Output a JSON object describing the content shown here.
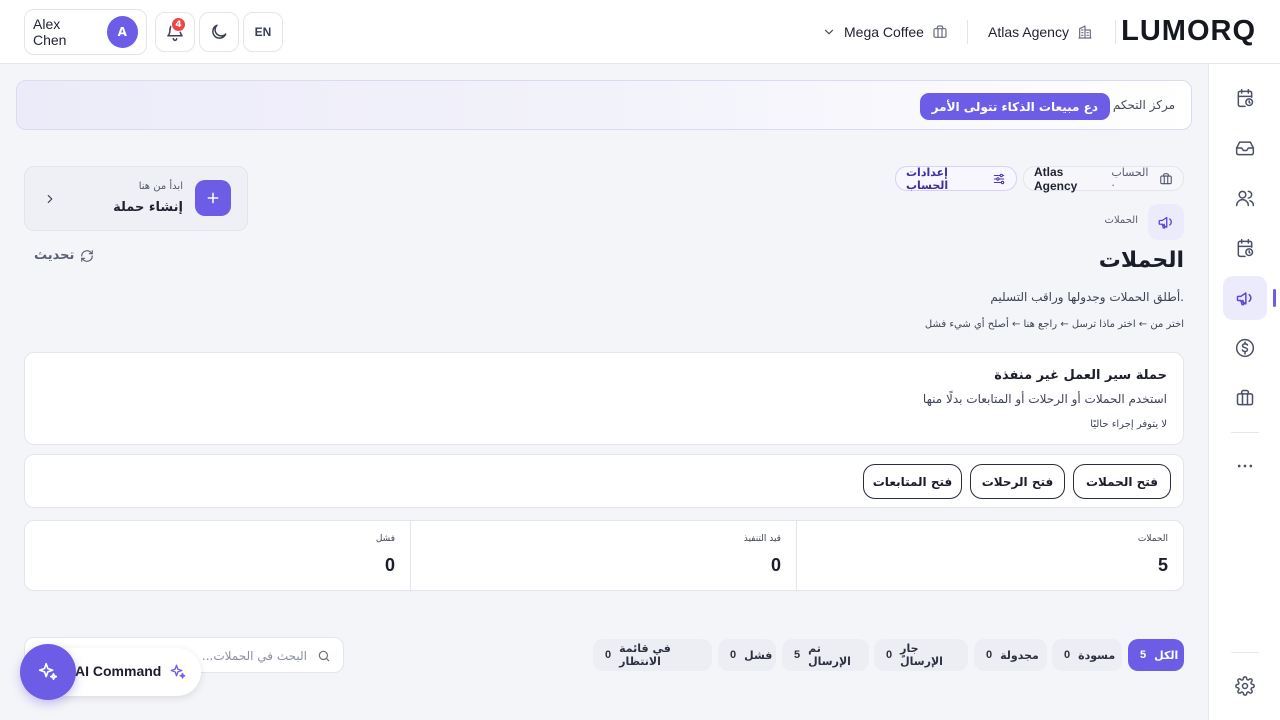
{
  "header": {
    "logo": "LUMORQ",
    "agency": "Atlas Agency",
    "brand": "Mega Coffee",
    "lang": "EN",
    "notifications": "4",
    "user_name": "Alex Chen",
    "avatar_initial": "A"
  },
  "banner": {
    "title": "مركز التحكم",
    "pill": "دع مبيعات الذكاء تتولى الأمر"
  },
  "create": {
    "subtitle": "ابدأ من هنا",
    "title": "إنشاء حملة"
  },
  "refresh_label": "تحديث",
  "account": {
    "prefix": "الحساب ·",
    "name": "Atlas Agency",
    "settings": "إعدادات الحساب"
  },
  "page": {
    "crumb": "الحملات",
    "title": "الحملات",
    "subtitle": "أطلق الحملات وجدولها وراقب التسليم.",
    "steps": "اختر من ← اختر ماذا ترسل ← راجع هنا ← أصلح أي شيء فشل"
  },
  "notice": {
    "title": "حملة سير العمل غير منفذة",
    "body": "استخدم الحملات أو الرحلات أو المتابعات بدلًا منها",
    "meta": "لا يتوفر إجراء حاليًا"
  },
  "open_buttons": [
    "فتح الحملات",
    "فتح الرحلات",
    "فتح المتابعات"
  ],
  "stats": [
    {
      "label": "الحملات",
      "value": "5"
    },
    {
      "label": "قيد التنفيذ",
      "value": "0"
    },
    {
      "label": "فشل",
      "value": "0"
    }
  ],
  "filters": [
    {
      "label": "الكل",
      "count": "5"
    },
    {
      "label": "مسودة",
      "count": "0"
    },
    {
      "label": "مجدولة",
      "count": "0"
    },
    {
      "label": "جارٍ الإرسال",
      "count": "0"
    },
    {
      "label": "تم الإرسال",
      "count": "5"
    },
    {
      "label": "فشل",
      "count": "0"
    },
    {
      "label": "في قائمة الانتظار",
      "count": "0"
    }
  ],
  "search": {
    "placeholder": "البحث في الحملات..."
  },
  "ai_command": "AI Command",
  "colors": {
    "accent": "#6d5de6",
    "badge": "#ef4444",
    "text": "#1b1d2b",
    "page_bg": "#f4f5f8"
  },
  "rail_icons": [
    "calendar-clock-icon",
    "inbox-icon",
    "users-icon",
    "calendar-clock-icon",
    "megaphone-icon",
    "dollar-icon",
    "briefcase-icon",
    "more-icon",
    "settings-icon"
  ]
}
